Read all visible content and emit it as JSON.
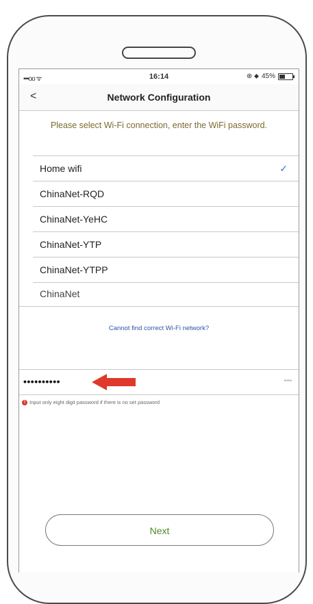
{
  "status_bar": {
    "signal": "•••oo ᯤ",
    "time": "16:14",
    "indicators": "⊕ ⬥",
    "battery_text": "45%",
    "battery_level": 0.45
  },
  "nav": {
    "back": "<",
    "title": "Network Configuration"
  },
  "instruction": "Please select Wi-Fi connection, enter the WiFi password.",
  "wifi_list": [
    {
      "name": "Home wifi",
      "selected": true
    },
    {
      "name": "ChinaNet-RQD",
      "selected": false
    },
    {
      "name": "ChinaNet-YeHC",
      "selected": false
    },
    {
      "name": "ChinaNet-YTP",
      "selected": false
    },
    {
      "name": "ChinaNet-YTPP",
      "selected": false
    },
    {
      "name": "ChinaNet",
      "selected": false
    }
  ],
  "check_glyph": "✓",
  "find_network_link": "Cannot find correct Wi-Fi network?",
  "password": {
    "value": "••••••••••",
    "eye_icon": "eye-closed-icon",
    "eye_glyph": "ᵕᵕᵕ"
  },
  "hint": {
    "icon": "!",
    "text": "Input only eight digit password if there is no set password"
  },
  "next_button": "Next",
  "colors": {
    "accent_green": "#4c8b2a",
    "link_blue": "#2a55a8",
    "check_blue": "#3a6fd8",
    "arrow_red": "#e0382a",
    "hint_red": "#d53a2a"
  }
}
